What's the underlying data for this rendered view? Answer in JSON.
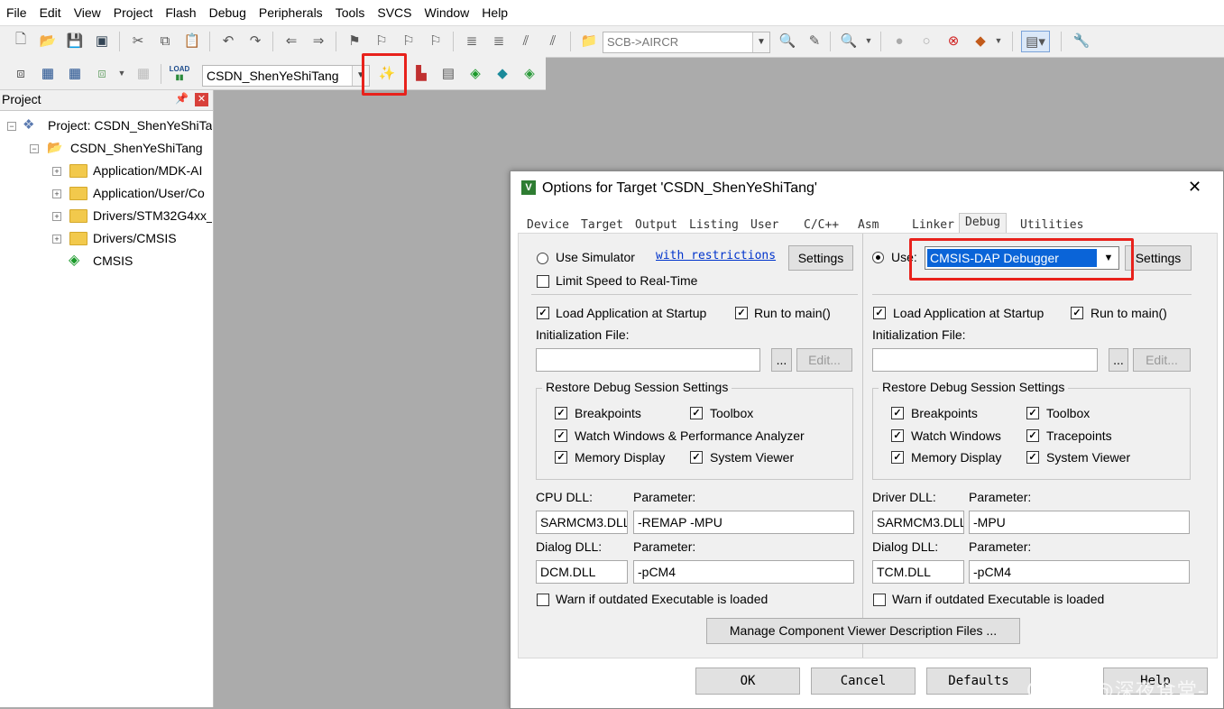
{
  "menu": [
    "File",
    "Edit",
    "View",
    "Project",
    "Flash",
    "Debug",
    "Peripherals",
    "Tools",
    "SVCS",
    "Window",
    "Help"
  ],
  "toolbar1": {
    "register_combo": "SCB->AIRCR"
  },
  "toolbar2": {
    "target_combo": "CSDN_ShenYeShiTang",
    "load_label": "LOAD"
  },
  "project_panel": {
    "title": "Project",
    "root": "Project: CSDN_ShenYeShiTar",
    "target": "CSDN_ShenYeShiTang",
    "groups": [
      "Application/MDK-AI",
      "Application/User/Co",
      "Drivers/STM32G4xx_",
      "Drivers/CMSIS"
    ],
    "cmsis": "CMSIS"
  },
  "dialog": {
    "title": "Options for Target 'CSDN_ShenYeShiTang'",
    "tabs": [
      "Device",
      "Target",
      "Output",
      "Listing",
      "User",
      "C/C++",
      "Asm",
      "Linker",
      "Debug",
      "Utilities"
    ],
    "active_tab": "Debug",
    "left": {
      "use_simulator": "Use Simulator",
      "restrictions_link": "with restrictions",
      "settings": "Settings",
      "limit_speed": "Limit Speed to Real-Time",
      "load_app": "Load Application at Startup",
      "run_to_main": "Run to main()",
      "init_file_label": "Initialization File:",
      "browse": "...",
      "edit": "Edit...",
      "restore_title": "Restore Debug Session Settings",
      "breakpoints": "Breakpoints",
      "toolbox": "Toolbox",
      "watch": "Watch Windows & Performance Analyzer",
      "memory": "Memory Display",
      "sysviewer": "System Viewer",
      "cpu_dll_label": "CPU DLL:",
      "param_label": "Parameter:",
      "cpu_dll": "SARMCM3.DLL",
      "cpu_param": "-REMAP -MPU",
      "dialog_dll_label": "Dialog DLL:",
      "dialog_dll": "DCM.DLL",
      "dialog_param": "-pCM4",
      "warn": "Warn if outdated Executable is loaded"
    },
    "right": {
      "use": "Use:",
      "debugger": "CMSIS-DAP Debugger",
      "settings": "Settings",
      "load_app": "Load Application at Startup",
      "run_to_main": "Run to main()",
      "init_file_label": "Initialization File:",
      "browse": "...",
      "edit": "Edit...",
      "restore_title": "Restore Debug Session Settings",
      "breakpoints": "Breakpoints",
      "toolbox": "Toolbox",
      "watch": "Watch Windows",
      "tracepoints": "Tracepoints",
      "memory": "Memory Display",
      "sysviewer": "System Viewer",
      "driver_dll_label": "Driver DLL:",
      "param_label": "Parameter:",
      "driver_dll": "SARMCM3.DLL",
      "driver_param": "-MPU",
      "dialog_dll_label": "Dialog DLL:",
      "dialog_dll": "TCM.DLL",
      "dialog_param": "-pCM4",
      "warn": "Warn if outdated Executable is loaded"
    },
    "manage_btn": "Manage Component Viewer Description Files ...",
    "ok": "OK",
    "cancel": "Cancel",
    "defaults": "Defaults",
    "help": "Help"
  },
  "watermark": "CSDN @深夜食堂-",
  "colors": {
    "highlight": "#e8221c",
    "selection": "#0a64d8",
    "link": "#0033cc"
  }
}
